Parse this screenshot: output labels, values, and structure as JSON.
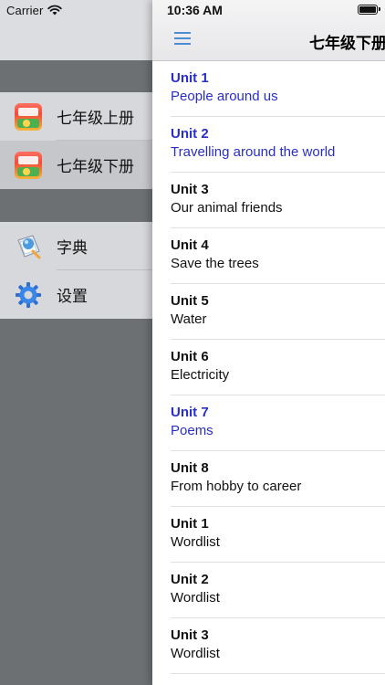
{
  "status_bar": {
    "carrier": "Carrier",
    "time": "10:36 AM"
  },
  "nav": {
    "title": "七年级下册",
    "menu_icon": "hamburger-icon"
  },
  "menu": {
    "books": [
      {
        "label": "七年级上册",
        "icon": "book-cover-icon",
        "selected": false
      },
      {
        "label": "七年级下册",
        "icon": "book-cover-icon",
        "selected": true
      }
    ],
    "tools": [
      {
        "label": "字典",
        "icon": "dictionary-icon"
      },
      {
        "label": "设置",
        "icon": "gear-icon"
      }
    ]
  },
  "units": [
    {
      "title": "Unit 1",
      "subtitle": "People around us",
      "highlighted": true
    },
    {
      "title": "Unit 2",
      "subtitle": "Travelling around the world",
      "highlighted": true
    },
    {
      "title": "Unit 3",
      "subtitle": "Our animal friends",
      "highlighted": false
    },
    {
      "title": "Unit 4",
      "subtitle": "Save the trees",
      "highlighted": false
    },
    {
      "title": "Unit 5",
      "subtitle": "Water",
      "highlighted": false
    },
    {
      "title": "Unit 6",
      "subtitle": "Electricity",
      "highlighted": false
    },
    {
      "title": "Unit 7",
      "subtitle": "Poems",
      "highlighted": true
    },
    {
      "title": "Unit 8",
      "subtitle": "From hobby to career",
      "highlighted": false
    },
    {
      "title": "Unit 1",
      "subtitle": "Wordlist",
      "highlighted": false
    },
    {
      "title": "Unit 2",
      "subtitle": "Wordlist",
      "highlighted": false
    },
    {
      "title": "Unit 3",
      "subtitle": "Wordlist",
      "highlighted": false
    }
  ],
  "colors": {
    "highlight_text": "#2a2ec9",
    "accent_icon": "#4a8fd6",
    "menu_background": "#6d7073"
  }
}
